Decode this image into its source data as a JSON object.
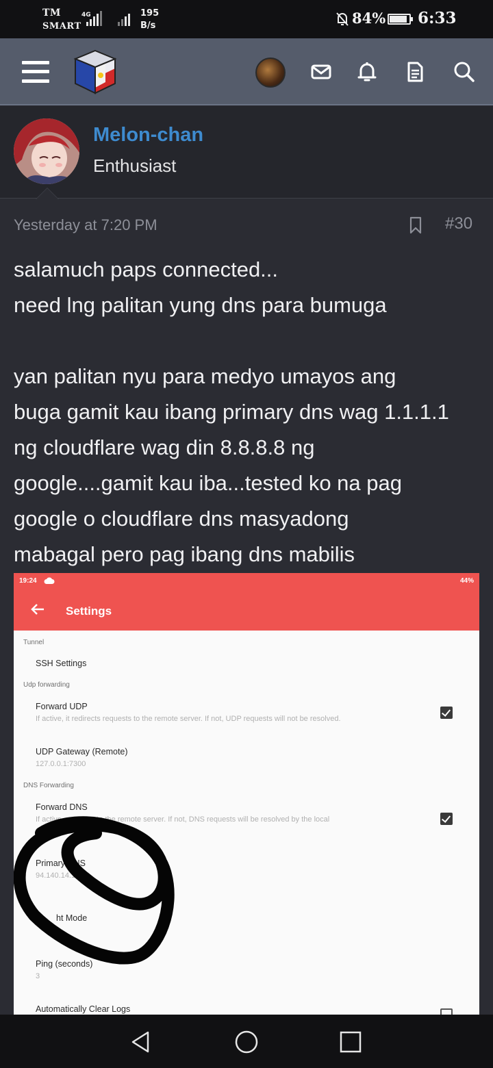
{
  "status_bar": {
    "carrier_line1": "TM",
    "carrier_line2": "SMART",
    "network_type": "4G",
    "speed_value": "195",
    "speed_unit": "B/s",
    "battery": "84%",
    "time": "6:33"
  },
  "header": {
    "icons": [
      "menu-icon",
      "site-logo",
      "user-avatar",
      "mail-icon",
      "bell-icon",
      "document-icon",
      "search-icon"
    ]
  },
  "author": {
    "name": "Melon-chan",
    "title": "Enthusiast",
    "name_color": "#3e8bcf"
  },
  "post": {
    "date": "Yesterday at 7:20 PM",
    "number": "#30",
    "lines_a": [
      "salamuch paps connected...",
      "need lng palitan yung dns para bumuga"
    ],
    "lines_b": [
      "yan palitan nyu para medyo umayos ang",
      "buga gamit kau ibang primary dns wag 1.1.1.1",
      "ng cloudflare wag din 8.8.8.8 ng",
      "google....gamit kau iba...tested ko na pag",
      "google o cloudflare dns masyadong",
      "mabagal pero pag ibang dns mabilis"
    ]
  },
  "attachment": {
    "status_time": "19:24",
    "status_battery": "44%",
    "title": "Settings",
    "accent": "#ef5350",
    "cat_tunnel": "Tunnel",
    "ssh_settings": "SSH Settings",
    "cat_udp": "Udp forwarding",
    "forward_udp": "Forward UDP",
    "forward_udp_desc": "If active, it redirects requests to the remote server. If not, UDP requests will not be resolved.",
    "udp_gateway": "UDP Gateway (Remote)",
    "udp_gateway_value": "127.0.0.1:7300",
    "cat_dns": "DNS Forwarding",
    "forward_dns": "Forward DNS",
    "forward_dns_desc": "If active,        requests to the remote server. If not, DNS requests will be resolved by the local",
    "primary_dns": "Primary DNS",
    "primary_dns_value": "94.140.14.14",
    "light_mode": "ht Mode",
    "ping": "Ping (seconds)",
    "ping_value": "3",
    "auto_clear": "Automatically Clear Logs"
  }
}
